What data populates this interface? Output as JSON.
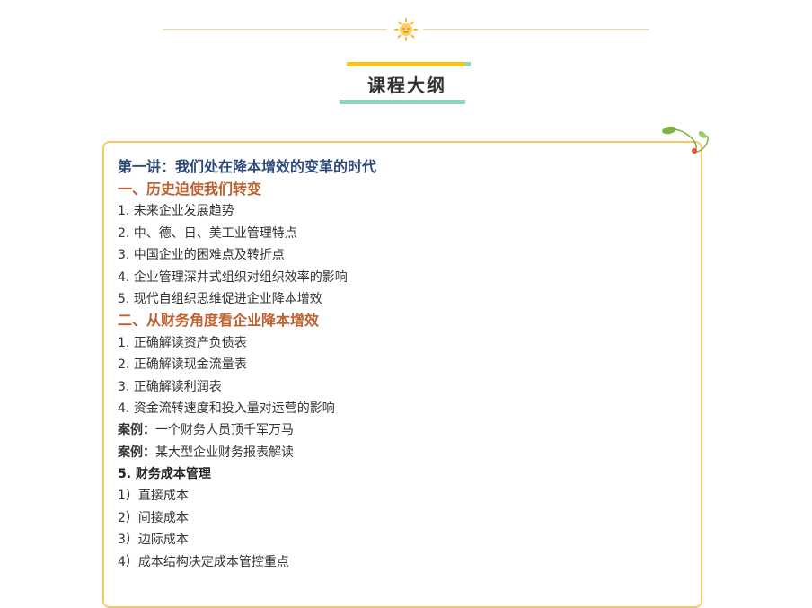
{
  "header": {
    "title": "课程大纲",
    "icon": "sun-icon"
  },
  "colors": {
    "rule": "#f2d79a",
    "title_bar_yellow": "#f5c518",
    "title_bar_teal": "#8fd3c1",
    "frame_border": "#f5c96a",
    "lecture_text": "#2f4a7a",
    "section_text": "#c0602f"
  },
  "outline": {
    "lecture": "第一讲：我们处在降本增效的变革的时代",
    "section1": {
      "title": "一、历史迫使我们转变",
      "items": [
        "1. 未来企业发展趋势",
        "2. 中、德、日、美工业管理特点",
        "3. 中国企业的困难点及转折点",
        "4. 企业管理深井式组织对组织效率的影响",
        "5. 现代自组织思维促进企业降本增效"
      ]
    },
    "section2": {
      "title": "二、从财务角度看企业降本增效",
      "items": [
        "1. 正确解读资产负债表",
        "2. 正确解读现金流量表",
        "3. 正确解读利润表",
        "4. 资金流转速度和投入量对运营的影响"
      ],
      "cases": [
        {
          "label": "案例：",
          "text": "一个财务人员顶千军万马"
        },
        {
          "label": "案例：",
          "text": "某大型企业财务报表解读"
        }
      ],
      "subhead": "5. 财务成本管理",
      "subitems": [
        "1）直接成本",
        "2）间接成本",
        "3）边际成本",
        "4）成本结构决定成本管控重点"
      ]
    }
  }
}
